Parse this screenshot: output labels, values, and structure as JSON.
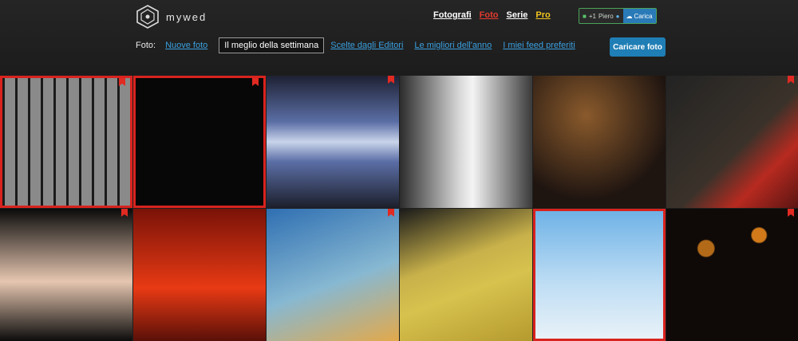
{
  "logo": {
    "text": "mywed"
  },
  "mainnav": [
    {
      "label": "Fotografi",
      "color": "#ffffff"
    },
    {
      "label": "Foto",
      "color": "#e33a2f"
    },
    {
      "label": "Serie",
      "color": "#ffffff"
    },
    {
      "label": "Pro",
      "color": "#f3c61f"
    }
  ],
  "user": {
    "count": "+1",
    "name": "Piero",
    "upload": "Carica"
  },
  "subnav": {
    "label": "Foto:",
    "items": [
      "Nuove foto",
      "Il meglio della settimana",
      "Scelte dagli Editori",
      "Le migliori dell'anno",
      "I miei feed preferiti"
    ],
    "active": "Il meglio della settimana"
  },
  "upload_button": "Caricare foto",
  "photos": [
    {
      "icon": "photo-icon"
    },
    {
      "icon": "photo-icon"
    },
    {
      "icon": "photo-icon"
    },
    {
      "icon": "photo-icon"
    },
    {
      "icon": "photo-icon"
    },
    {
      "icon": "photo-icon"
    },
    {
      "icon": "photo-icon"
    },
    {
      "icon": "photo-icon"
    },
    {
      "icon": "photo-icon"
    },
    {
      "icon": "photo-icon"
    },
    {
      "icon": "photo-icon"
    },
    {
      "icon": "photo-icon"
    }
  ]
}
